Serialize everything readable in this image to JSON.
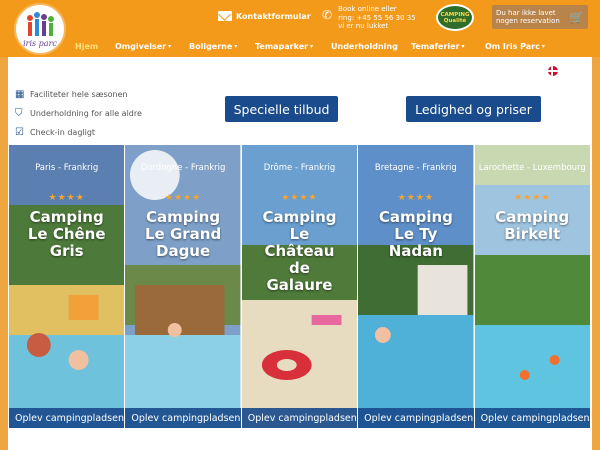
{
  "header": {
    "logo_text": "iris parc",
    "contact_label": "Kontaktformular",
    "phone_lines": [
      "Book online eller",
      "ring: +45 55 56 30 35",
      "vi er nu lukket"
    ],
    "camping_badge_line1": "CAMPING",
    "camping_badge_line2": "Qualité",
    "reservation_lines": [
      "Du har ikke lavet",
      "nogen reservation"
    ]
  },
  "nav": {
    "items": [
      {
        "label": "Hjem",
        "active": true
      },
      {
        "label": "Omgivelser",
        "dropdown": true
      },
      {
        "label": "Boligerne",
        "dropdown": true
      },
      {
        "label": "Temaparker",
        "dropdown": true
      },
      {
        "label": "Underholdning",
        "dropdown": false
      },
      {
        "label": "Temaferier",
        "dropdown": true
      },
      {
        "label": "Om Iris Parc",
        "dropdown": true
      }
    ]
  },
  "features": [
    {
      "icon": "calendar-icon",
      "label": "Faciliteter hele sæsonen"
    },
    {
      "icon": "badge-icon",
      "label": "Underholdning for alle aldre"
    },
    {
      "icon": "check-icon",
      "label": "Check-in dagligt"
    }
  ],
  "buttons": {
    "offers": "Specielle tilbud",
    "availability": "Ledighed og priser"
  },
  "cards": [
    {
      "region": "Paris - Frankrig",
      "stars": "★★★★",
      "title": [
        "Camping",
        "Le Chêne",
        "Gris"
      ],
      "cta": "Oplev campingpladsen"
    },
    {
      "region": "Dordogne - Frankrig",
      "stars": "★★★★",
      "title": [
        "Camping",
        "Le Grand",
        "Dague"
      ],
      "cta": "Oplev campingpladsen"
    },
    {
      "region": "Drôme - Frankrig",
      "stars": "★★★★",
      "title": [
        "Camping",
        "Le",
        "Château",
        "de",
        "Galaure"
      ],
      "cta": "Oplev campingpladsen"
    },
    {
      "region": "Bretagne - Frankrig",
      "stars": "★★★★",
      "title": [
        "Camping",
        "Le Ty",
        "Nadan"
      ],
      "cta": "Oplev campingpladsen"
    },
    {
      "region": "Larochette - Luxembourg",
      "stars": "★★★★",
      "title": [
        "Camping",
        "Birkelt"
      ],
      "cta": "Oplev campingpladsen"
    }
  ],
  "colors": {
    "orange": "#f39a1a",
    "blue": "#1a4c8d",
    "star": "#f4a530"
  }
}
